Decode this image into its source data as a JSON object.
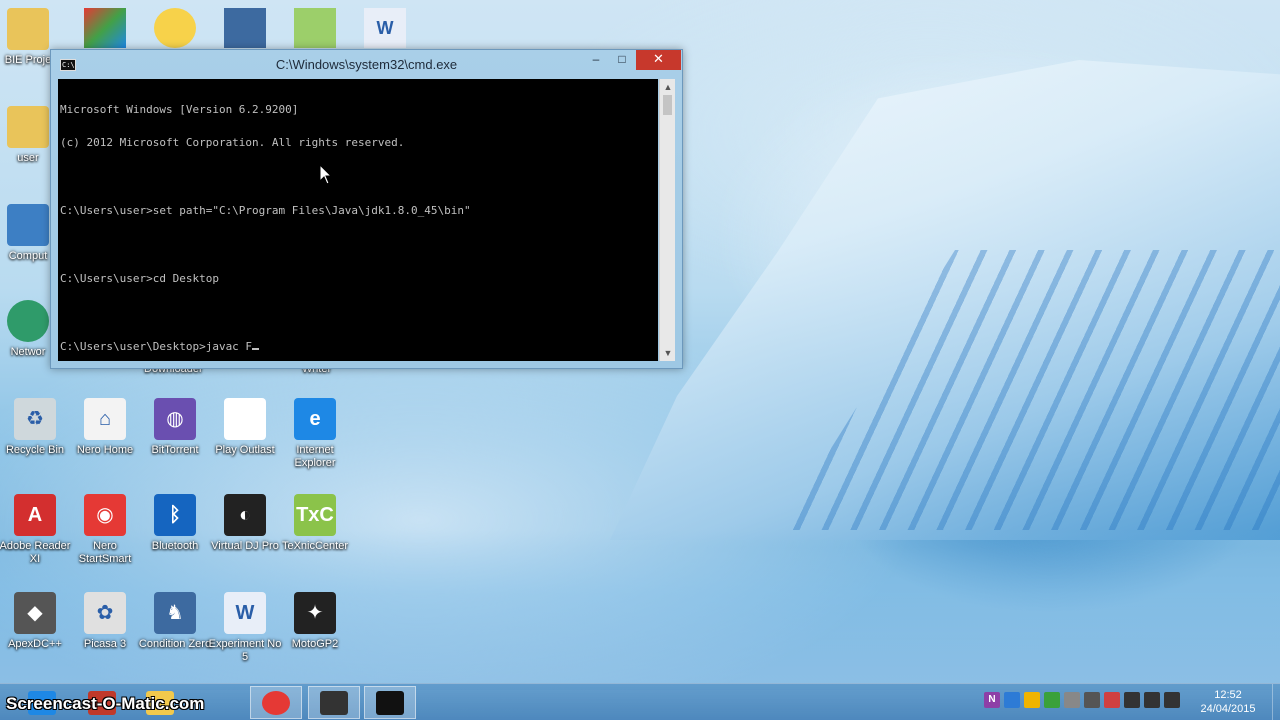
{
  "desktop": {
    "partial_icons": [
      {
        "label": "BIE Proje",
        "icon": "folder-icon"
      },
      {
        "label": "user",
        "icon": "user-folder-icon"
      },
      {
        "label": "Comput",
        "icon": "computer-icon"
      },
      {
        "label": "Networ",
        "icon": "network-icon"
      }
    ],
    "hidden_labels": {
      "downloader": "Downloader",
      "writer": "Writer"
    },
    "icons": [
      {
        "label": "Recycle Bin",
        "icon": "recycle-bin-icon"
      },
      {
        "label": "Nero Home",
        "icon": "nero-home-icon"
      },
      {
        "label": "BitTorrent",
        "icon": "bittorrent-icon"
      },
      {
        "label": "Play Outlast",
        "icon": "document-icon"
      },
      {
        "label": "Internet Explorer",
        "icon": "internet-explorer-icon"
      },
      {
        "label": "Adobe Reader XI",
        "icon": "adobe-reader-icon"
      },
      {
        "label": "Nero StartSmart",
        "icon": "nero-startsmart-icon"
      },
      {
        "label": "Bluetooth",
        "icon": "bluetooth-icon"
      },
      {
        "label": "Virtual DJ Pro",
        "icon": "virtual-dj-icon"
      },
      {
        "label": "TeXnicCenter",
        "icon": "texniccenter-icon"
      },
      {
        "label": "ApexDC++",
        "icon": "apexdc-icon"
      },
      {
        "label": "Picasa 3",
        "icon": "picasa-icon"
      },
      {
        "label": "Condition Zero",
        "icon": "condition-zero-icon"
      },
      {
        "label": "Experiment No 5",
        "icon": "word-document-icon"
      },
      {
        "label": "MotoGP2",
        "icon": "motogp-icon"
      }
    ]
  },
  "cmd": {
    "title": "C:\\Windows\\system32\\cmd.exe",
    "icon_text": "C:\\",
    "buttons": {
      "minimize": "‒",
      "maximize": "□",
      "close": "✕"
    },
    "lines": [
      "Microsoft Windows [Version 6.2.9200]",
      "(c) 2012 Microsoft Corporation. All rights reserved.",
      "",
      "C:\\Users\\user>set path=\"C:\\Program Files\\Java\\jdk1.8.0_45\\bin\"",
      "",
      "C:\\Users\\user>cd Desktop",
      "",
      "C:\\Users\\user\\Desktop>javac F"
    ]
  },
  "taskbar": {
    "items": [
      {
        "name": "internet-explorer-taskbar-icon",
        "color": "#1e88e5"
      },
      {
        "name": "media-taskbar-icon",
        "color": "#c0392b"
      },
      {
        "name": "file-explorer-taskbar-icon",
        "color": "#f2c94c"
      },
      {
        "name": "chrome-taskbar-icon",
        "color": "#e53935"
      },
      {
        "name": "snipping-taskbar-icon",
        "color": "#333333"
      },
      {
        "name": "cmd-taskbar-icon",
        "color": "#111111"
      }
    ],
    "tray": [
      {
        "name": "onenote-tray-icon",
        "glyph": "N",
        "color": "#8e3fa7"
      },
      {
        "name": "tray-icon-2",
        "glyph": "",
        "color": "#2d7bd6"
      },
      {
        "name": "tray-icon-3",
        "glyph": "",
        "color": "#f0b400"
      },
      {
        "name": "tray-icon-4",
        "glyph": "",
        "color": "#3aa13a"
      },
      {
        "name": "tray-icon-5",
        "glyph": "",
        "color": "#888888"
      },
      {
        "name": "tray-icon-6",
        "glyph": "",
        "color": "#555555"
      },
      {
        "name": "tray-icon-7",
        "glyph": "",
        "color": "#d04040"
      },
      {
        "name": "signal-tray-icon",
        "glyph": "",
        "color": "#333333"
      },
      {
        "name": "volume-tray-icon",
        "glyph": "",
        "color": "#333333"
      },
      {
        "name": "power-tray-icon",
        "glyph": "",
        "color": "#333333"
      }
    ],
    "clock": {
      "time": "12:52",
      "date": "24/04/2015"
    }
  },
  "watermark": "Screencast-O-Matic.com"
}
